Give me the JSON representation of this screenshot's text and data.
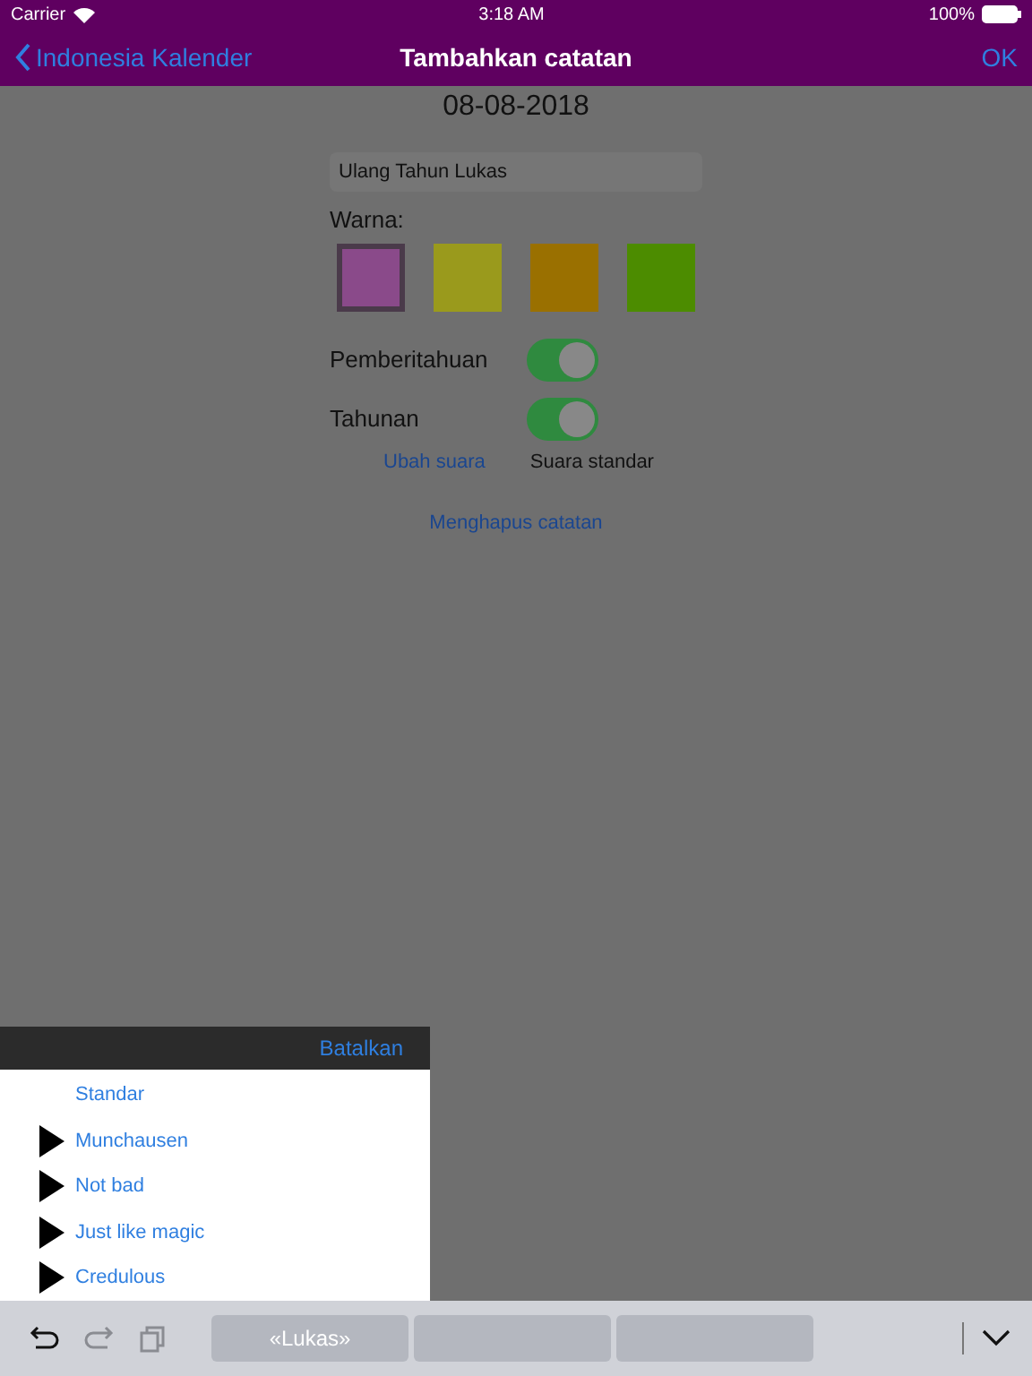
{
  "status_bar": {
    "carrier": "Carrier",
    "time": "3:18 AM",
    "battery": "100%"
  },
  "nav_bar": {
    "back": "Indonesia Kalender",
    "title": "Tambahkan catatan",
    "action": "OK"
  },
  "date": "08-08-2018",
  "note_field": {
    "value": "Ulang Tahun Lukas"
  },
  "color_label": "Warna:",
  "colors": [
    {
      "color": "#8a4a8a",
      "selected": true
    },
    {
      "color": "#9a9a1c",
      "selected": false
    },
    {
      "color": "#9a7000",
      "selected": false
    },
    {
      "color": "#4c8c00",
      "selected": false
    }
  ],
  "toggles": [
    {
      "label": "Pemberitahuan",
      "on": true
    },
    {
      "label": "Tahunan",
      "on": true
    }
  ],
  "sound": {
    "change_link": "Ubah suara",
    "current": "Suara standar"
  },
  "delete_link": "Menghapus catatan",
  "sound_picker": {
    "cancel": "Batalkan",
    "items": [
      {
        "label": "Standar",
        "playable": false
      },
      {
        "label": "Munchausen",
        "playable": true
      },
      {
        "label": "Not bad",
        "playable": true
      },
      {
        "label": "Just like magic",
        "playable": true
      },
      {
        "label": "Credulous",
        "playable": true
      }
    ]
  },
  "keyboard_bar": {
    "tools": [
      {
        "kind": "undo",
        "disabled": false
      },
      {
        "kind": "redo",
        "disabled": true
      },
      {
        "kind": "paste",
        "disabled": true
      }
    ],
    "suggestions": [
      "«Lukas»"
    ]
  }
}
